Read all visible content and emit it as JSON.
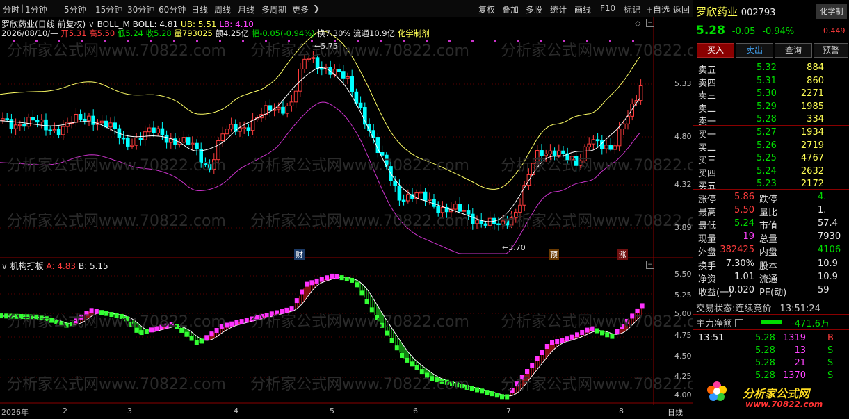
{
  "toolbar": {
    "periods": [
      "分时",
      "1分钟",
      "5分钟",
      "15分钟",
      "30分钟",
      "60分钟",
      "日线",
      "周线",
      "月线",
      "多周期",
      "更多"
    ],
    "right_tools": [
      "复权",
      "叠加",
      "多股",
      "统计",
      "画线",
      "F10",
      "标记",
      "+自选",
      "返回"
    ]
  },
  "main_chart": {
    "stock_header": "罗欣药业(日线 前复权)",
    "indicator_name": "BOLL_M",
    "boll_label": "BOLL: 4.81",
    "ub_label": "UB: 5.51",
    "lb_label": "LB: 4.10",
    "info_line": {
      "date": "2026/08/10/—",
      "open": "开5.31",
      "high": "高5.50",
      "low": "低5.24",
      "close": "收5.28",
      "volume": "量793025",
      "amount": "额4.25亿",
      "change": "幅-0.05(-0.94%)",
      "turnover": "换7.30%",
      "float": "流通10.9亿",
      "sector": "化学制剂"
    },
    "high_marker": "5.75",
    "low_marker": "3.70",
    "y_ticks": [
      "5.33",
      "4.80",
      "4.32",
      "3.89"
    ],
    "event_tags": [
      "财",
      "预",
      "涨"
    ],
    "colors": {
      "up": "#ff3c3c",
      "down": "#00ffff",
      "mid": "#ffffff",
      "upper": "#ffff66",
      "lower": "#cc33cc"
    }
  },
  "sub_chart": {
    "title": "机构打板",
    "a_label": "A: 4.83",
    "b_label": "B: 5.15",
    "y_ticks": [
      "5.50",
      "5.25",
      "5.00",
      "4.75",
      "4.50",
      "4.25",
      "4.00"
    ]
  },
  "x_axis": {
    "labels": [
      "2026年",
      "2",
      "3",
      "4",
      "5",
      "6",
      "7",
      "8"
    ],
    "period": "日线"
  },
  "quote": {
    "name": "罗欣药业",
    "code": "002793",
    "sector_tab": "化学制",
    "price": "5.28",
    "change": "-0.05",
    "change_pct": "-0.94%",
    "side_value": "0.449",
    "buttons": [
      "买入",
      "卖出",
      "查询",
      "预警"
    ],
    "sells": [
      {
        "label": "卖五",
        "price": "5.32",
        "vol": "884"
      },
      {
        "label": "卖四",
        "price": "5.31",
        "vol": "860"
      },
      {
        "label": "卖三",
        "price": "5.30",
        "vol": "2271"
      },
      {
        "label": "卖二",
        "price": "5.29",
        "vol": "1985"
      },
      {
        "label": "卖一",
        "price": "5.28",
        "vol": "334"
      }
    ],
    "buys": [
      {
        "label": "买一",
        "price": "5.27",
        "vol": "1934"
      },
      {
        "label": "买二",
        "price": "5.26",
        "vol": "2719"
      },
      {
        "label": "买三",
        "price": "5.25",
        "vol": "4767"
      },
      {
        "label": "买四",
        "price": "5.24",
        "vol": "2632"
      },
      {
        "label": "买五",
        "price": "5.23",
        "vol": "2172"
      }
    ],
    "stats": [
      {
        "l1": "涨停",
        "v1": "5.86",
        "l2": "跌停",
        "v2": "4."
      },
      {
        "l1": "最高",
        "v1": "5.50",
        "l2": "量比",
        "v2": "1."
      },
      {
        "l1": "最低",
        "v1": "5.24",
        "l2": "市值",
        "v2": "57.4"
      },
      {
        "l1": "现量",
        "v1": "19",
        "l2": "总量",
        "v2": "7930"
      },
      {
        "l1": "外盘",
        "v1": "382425",
        "l2": "内盘",
        "v2": "4106"
      }
    ],
    "stats2": [
      {
        "l1": "换手",
        "v1": "7.30%",
        "l2": "股本",
        "v2": "10.9"
      },
      {
        "l1": "净资",
        "v1": "1.01",
        "l2": "流通",
        "v2": "10.9"
      },
      {
        "l1": "收益(一)",
        "v1": "0.020",
        "l2": "PE(动)",
        "v2": "59"
      }
    ],
    "trade_status_label": "交易状态:",
    "trade_status": "连续竞价",
    "trade_time": "13:51:24",
    "main_net_label": "主力净额",
    "main_net": "-471.6万",
    "ticks": [
      {
        "time": "13:51",
        "price": "5.28",
        "vol": "1319",
        "side": "B"
      },
      {
        "time": "",
        "price": "5.28",
        "vol": "13",
        "side": "S"
      },
      {
        "time": "",
        "price": "5.28",
        "vol": "21",
        "side": "S"
      },
      {
        "time": "",
        "price": "5.28",
        "vol": "1370",
        "side": "S"
      }
    ],
    "logo_text": "分析家公式网",
    "logo_url": "www.70822.com"
  },
  "watermark": "分析家公式网www.70822.com"
}
